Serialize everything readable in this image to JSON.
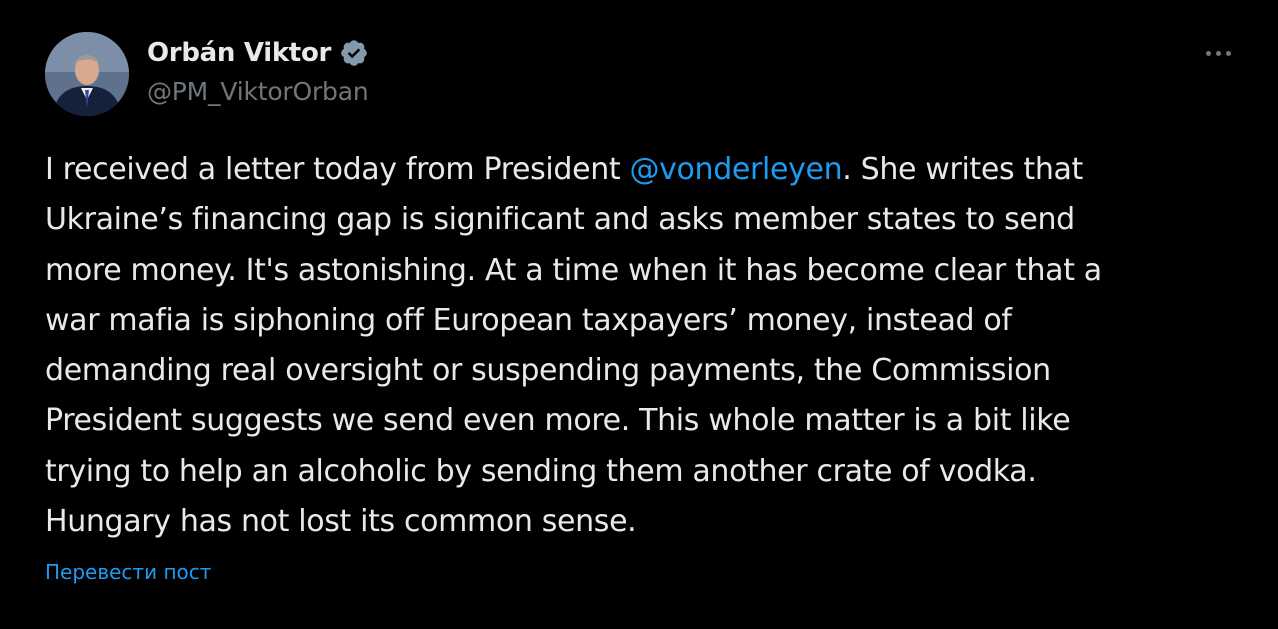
{
  "author": {
    "display_name": "Orbán Viktor",
    "handle": "@PM_ViktorOrban",
    "verified": true,
    "avatar_icon": "profile-photo"
  },
  "post": {
    "lines": [
      {
        "before": "I received a letter today from President ",
        "mention": "@vonderleyen",
        "after": ". She writes that"
      },
      {
        "text": "Ukraine’s financing gap is significant and asks member states to send"
      },
      {
        "text": "more money. It's astonishing. At a time when it has become clear that a"
      },
      {
        "text": "war mafia is siphoning off European taxpayers’ money, instead of"
      },
      {
        "text": "demanding real oversight or suspending payments, the Commission"
      },
      {
        "text": "President suggests we send even more. This whole matter is a bit like"
      },
      {
        "text": "trying to help an alcoholic by sending them another crate of vodka."
      },
      {
        "text": "Hungary has not lost its common sense."
      }
    ],
    "translate_label": "Перевести пост"
  },
  "icons": {
    "more": "more-dots-icon",
    "verified": "verified-badge-icon"
  },
  "colors": {
    "background": "#000000",
    "text": "#e7e9ea",
    "secondary": "#71767b",
    "accent": "#1d9bf0"
  }
}
